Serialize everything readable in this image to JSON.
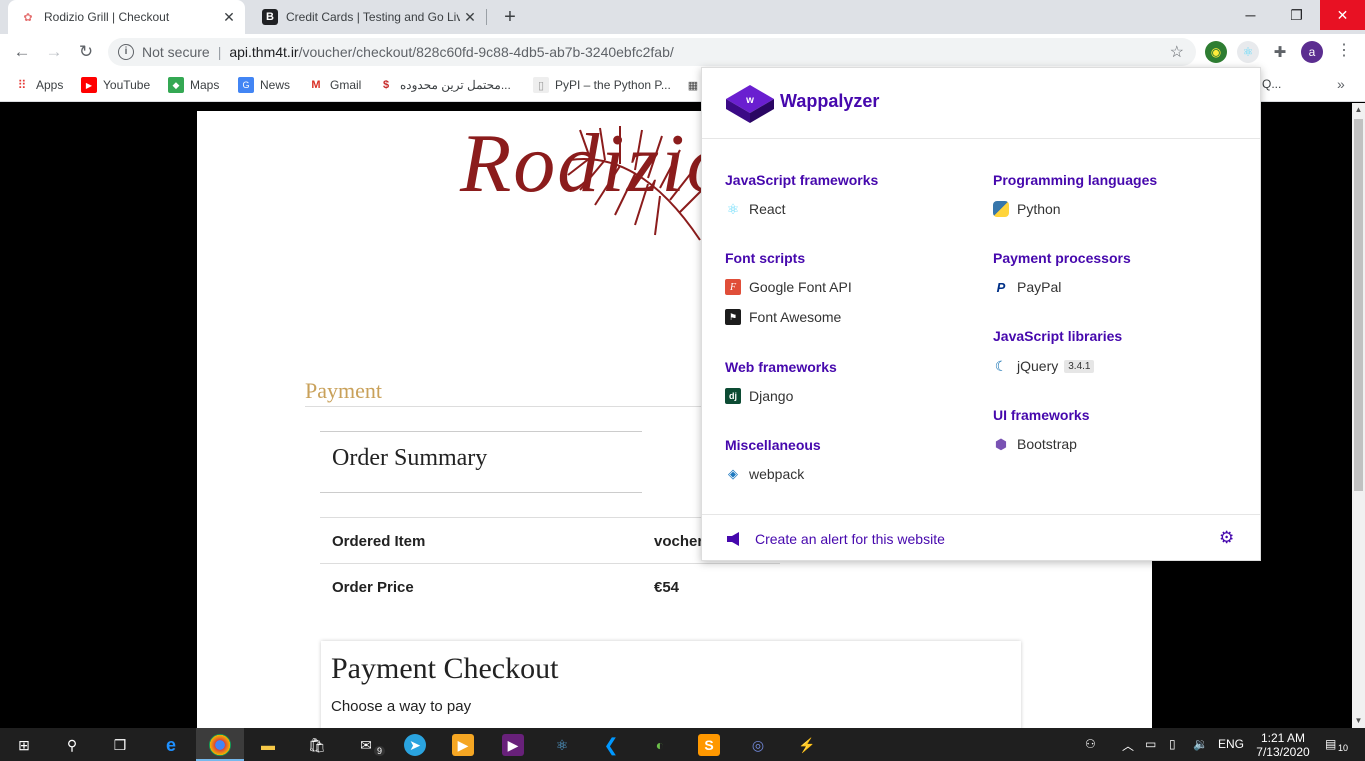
{
  "tabs": [
    {
      "title": "Rodizio Grill | Checkout",
      "icon": "brain-icon"
    },
    {
      "title": "Credit Cards | Testing and Go Live",
      "icon": "b-icon"
    }
  ],
  "window": {
    "minimize": "─",
    "restore": "❐",
    "close": "✕"
  },
  "toolbar": {
    "not_secure": "Not secure",
    "url_host": "api.thm4t.ir",
    "url_path": "/voucher/checkout/828c60fd-9c88-4db5-ab7b-3240ebfc2fab/",
    "avatar_letter": "a"
  },
  "bookmarks": [
    {
      "label": "Apps"
    },
    {
      "label": "YouTube"
    },
    {
      "label": "Maps"
    },
    {
      "label": "News"
    },
    {
      "label": "Gmail"
    },
    {
      "label": "محتمل ترین محدوده..."
    },
    {
      "label": "PyPI – the Python P..."
    },
    {
      "label": "Q..."
    }
  ],
  "page": {
    "logo": "Rodizio",
    "payment_heading": "Payment",
    "summary_title": "Order Summary",
    "rows": [
      {
        "label": "Ordered Item",
        "value": "vocher"
      },
      {
        "label": "Order Price",
        "value": "€54"
      }
    ],
    "checkout_title": "Payment Checkout",
    "checkout_sub": "Choose a way to pay"
  },
  "wappalyzer": {
    "brand": "Wappalyzer",
    "categories": [
      {
        "name": "JavaScript frameworks",
        "techs": [
          {
            "name": "React"
          }
        ]
      },
      {
        "name": "Font scripts",
        "techs": [
          {
            "name": "Google Font API"
          },
          {
            "name": "Font Awesome"
          }
        ]
      },
      {
        "name": "Web frameworks",
        "techs": [
          {
            "name": "Django"
          }
        ]
      },
      {
        "name": "Miscellaneous",
        "techs": [
          {
            "name": "webpack"
          }
        ]
      },
      {
        "name": "Programming languages",
        "techs": [
          {
            "name": "Python"
          }
        ]
      },
      {
        "name": "Payment processors",
        "techs": [
          {
            "name": "PayPal"
          }
        ]
      },
      {
        "name": "JavaScript libraries",
        "techs": [
          {
            "name": "jQuery",
            "version": "3.4.1"
          }
        ]
      },
      {
        "name": "UI frameworks",
        "techs": [
          {
            "name": "Bootstrap"
          }
        ]
      }
    ],
    "alert_link": "Create an alert for this website"
  },
  "taskbar": {
    "mail_badge": "9",
    "language": "ENG",
    "time": "1:21 AM",
    "date": "7/13/2020",
    "notifications": "10"
  },
  "colors": {
    "accent": "#4608ad",
    "logo": "#8b1c1c",
    "payment_heading": "#c9a15a"
  }
}
